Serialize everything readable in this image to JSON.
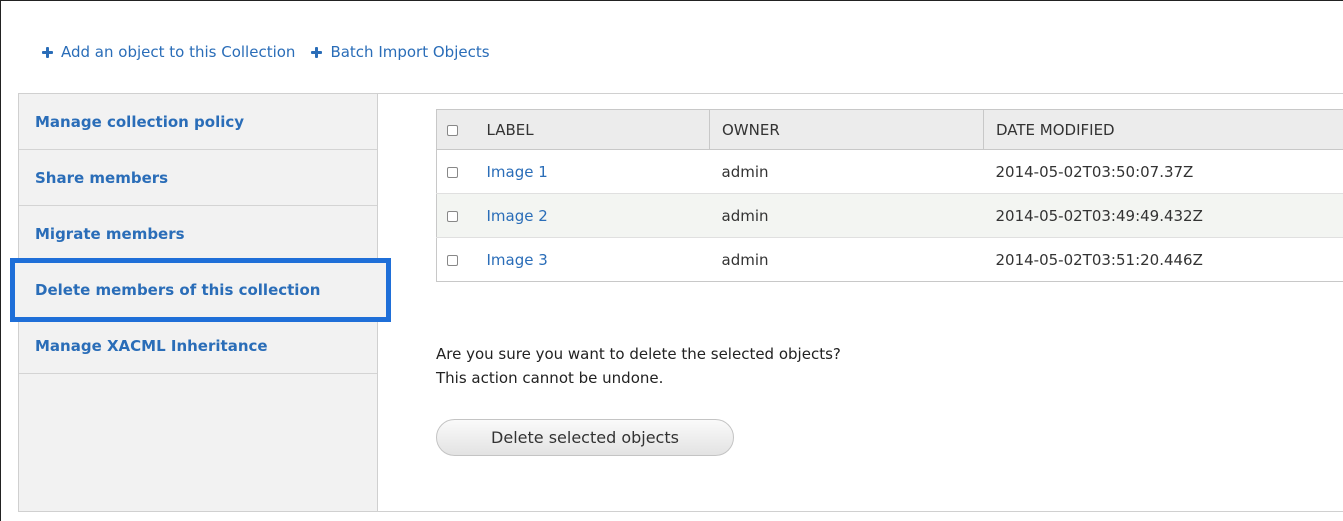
{
  "actions": [
    {
      "label": "Add an object to this Collection",
      "icon": "plus-icon"
    },
    {
      "label": "Batch Import Objects",
      "icon": "plus-icon"
    }
  ],
  "sidebar": {
    "items": [
      {
        "label": "Manage collection policy"
      },
      {
        "label": "Share members"
      },
      {
        "label": "Migrate members"
      },
      {
        "label": "Delete members of this collection",
        "selected": true
      },
      {
        "label": "Manage XACML Inheritance"
      }
    ]
  },
  "table": {
    "headers": [
      "LABEL",
      "OWNER",
      "DATE MODIFIED"
    ],
    "rows": [
      {
        "label": "Image 1",
        "owner": "admin",
        "date": "2014-05-02T03:50:07.37Z"
      },
      {
        "label": "Image 2",
        "owner": "admin",
        "date": "2014-05-02T03:49:49.432Z"
      },
      {
        "label": "Image 3",
        "owner": "admin",
        "date": "2014-05-02T03:51:20.446Z"
      }
    ]
  },
  "confirm": {
    "line1": "Are you sure you want to delete the selected objects?",
    "line2": "This action cannot be undone."
  },
  "delete_button": "Delete selected objects",
  "colors": {
    "link": "#2a6db8",
    "highlight": "#1f6fd8",
    "sidebar_bg": "#f2f2f2"
  }
}
